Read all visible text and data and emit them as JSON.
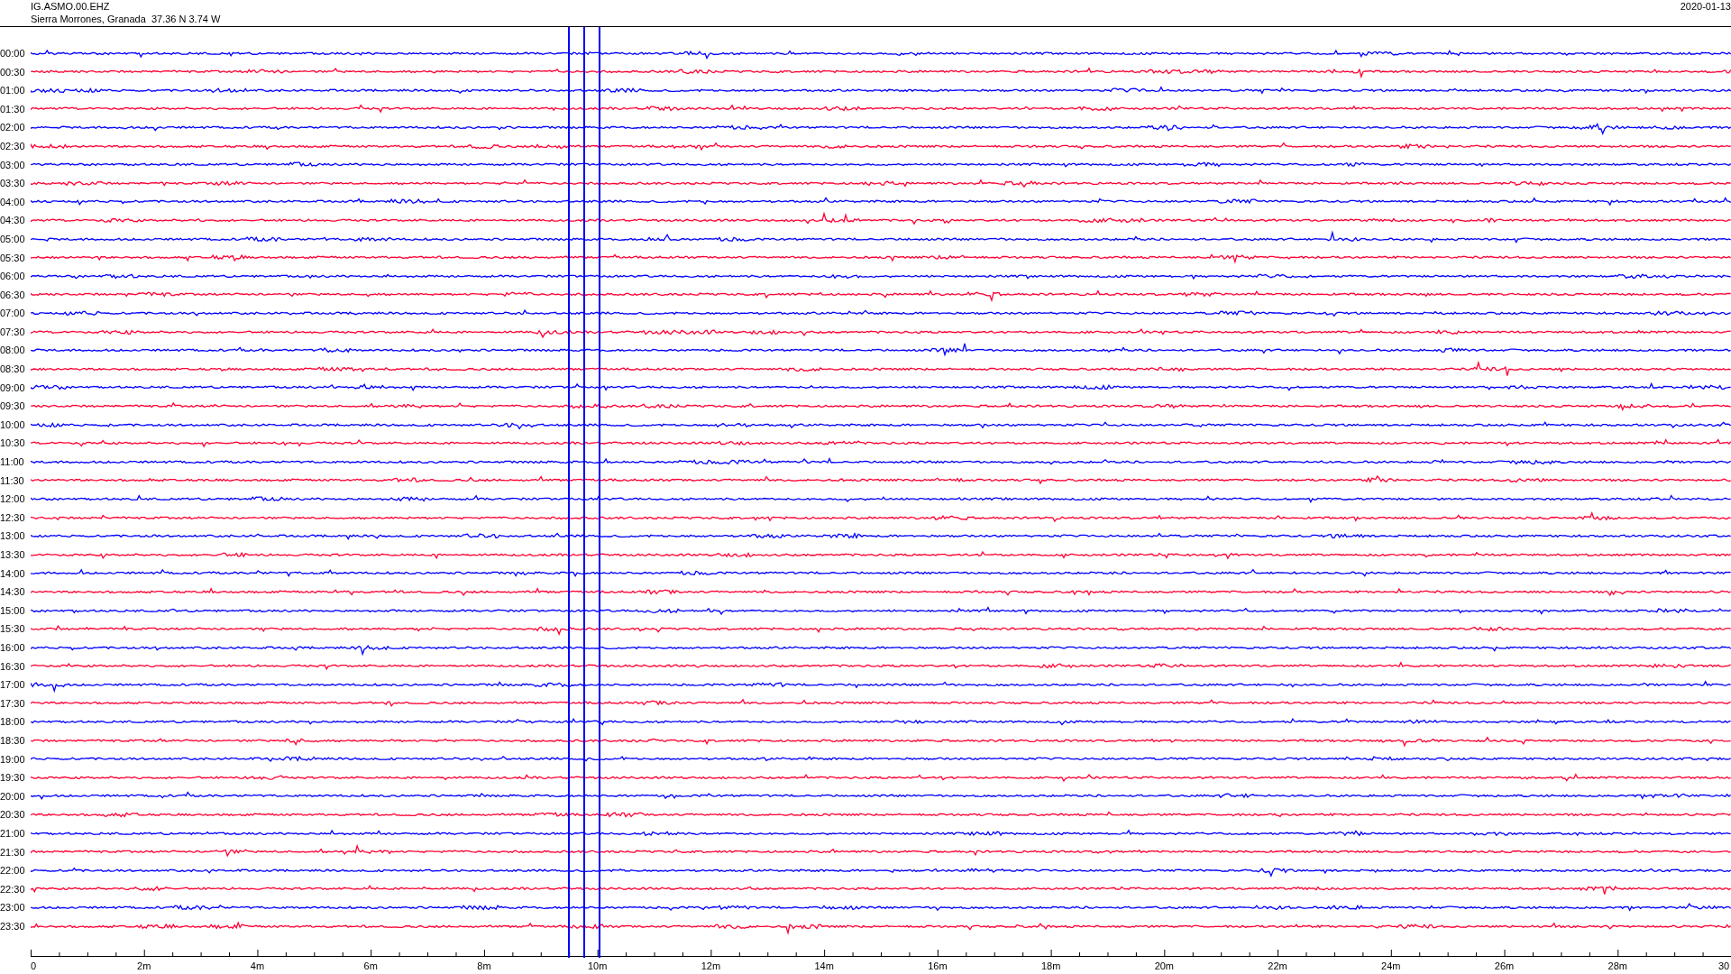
{
  "header": {
    "station": "IG.ASMO.00.EHZ",
    "location": "Sierra Morrones, Granada  37.36 N 3.74 W",
    "date": "2020-01-13"
  },
  "traces": [
    {
      "time": "00:00",
      "color": "#0000ff"
    },
    {
      "time": "00:30",
      "color": "#ff0033"
    },
    {
      "time": "01:00",
      "color": "#0000ff"
    },
    {
      "time": "01:30",
      "color": "#ff0033"
    },
    {
      "time": "02:00",
      "color": "#0000ff"
    },
    {
      "time": "02:30",
      "color": "#ff0033"
    },
    {
      "time": "03:00",
      "color": "#0000ff"
    },
    {
      "time": "03:30",
      "color": "#ff0033"
    },
    {
      "time": "04:00",
      "color": "#0000ff"
    },
    {
      "time": "04:30",
      "color": "#ff0033"
    },
    {
      "time": "05:00",
      "color": "#0000ff"
    },
    {
      "time": "05:30",
      "color": "#ff0033"
    },
    {
      "time": "06:00",
      "color": "#0000ff"
    },
    {
      "time": "06:30",
      "color": "#ff0033"
    },
    {
      "time": "07:00",
      "color": "#0000ff"
    },
    {
      "time": "07:30",
      "color": "#ff0033"
    },
    {
      "time": "08:00",
      "color": "#0000ff"
    },
    {
      "time": "08:30",
      "color": "#ff0033"
    },
    {
      "time": "09:00",
      "color": "#0000ff"
    },
    {
      "time": "09:30",
      "color": "#ff0033"
    },
    {
      "time": "10:00",
      "color": "#0000ff"
    },
    {
      "time": "10:30",
      "color": "#ff0033"
    },
    {
      "time": "11:00",
      "color": "#0000ff"
    },
    {
      "time": "11:30",
      "color": "#ff0033"
    },
    {
      "time": "12:00",
      "color": "#0000ff"
    },
    {
      "time": "12:30",
      "color": "#ff0033"
    },
    {
      "time": "13:00",
      "color": "#0000ff"
    },
    {
      "time": "13:30",
      "color": "#ff0033"
    },
    {
      "time": "14:00",
      "color": "#0000ff"
    },
    {
      "time": "14:30",
      "color": "#ff0033"
    },
    {
      "time": "15:00",
      "color": "#0000ff"
    },
    {
      "time": "15:30",
      "color": "#ff0033"
    },
    {
      "time": "16:00",
      "color": "#0000ff"
    },
    {
      "time": "16:30",
      "color": "#ff0033"
    },
    {
      "time": "17:00",
      "color": "#0000ff"
    },
    {
      "time": "17:30",
      "color": "#ff0033"
    },
    {
      "time": "18:00",
      "color": "#0000ff"
    },
    {
      "time": "18:30",
      "color": "#ff0033"
    },
    {
      "time": "19:00",
      "color": "#0000ff"
    },
    {
      "time": "19:30",
      "color": "#ff0033"
    },
    {
      "time": "20:00",
      "color": "#0000ff"
    },
    {
      "time": "20:30",
      "color": "#ff0033"
    },
    {
      "time": "21:00",
      "color": "#0000ff"
    },
    {
      "time": "21:30",
      "color": "#ff0033"
    },
    {
      "time": "22:00",
      "color": "#0000ff"
    },
    {
      "time": "22:30",
      "color": "#ff0033"
    },
    {
      "time": "23:00",
      "color": "#0000ff"
    },
    {
      "time": "23:30",
      "color": "#ff0033"
    }
  ],
  "axis": {
    "labels": [
      "0",
      "2m",
      "4m",
      "6m",
      "8m",
      "10m",
      "12m",
      "14m",
      "16m",
      "18m",
      "20m",
      "22m",
      "24m",
      "26m",
      "28m",
      "30"
    ]
  }
}
